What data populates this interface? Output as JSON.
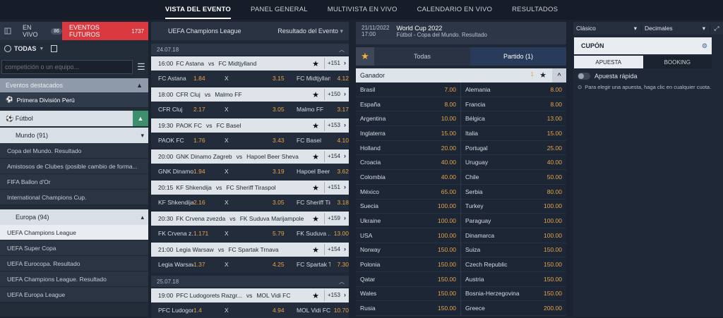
{
  "nav": {
    "tabs": [
      "VISTA DEL EVENTO",
      "PANEL GENERAL",
      "MULTIVISTA EN VIVO",
      "CALENDARIO EN VIVO",
      "RESULTADOS"
    ]
  },
  "left": {
    "live_label": "EN VIVO",
    "live_count": "86",
    "future_label": "EVENTOS FUTUROS",
    "future_count": "1737",
    "filter": "TODAS",
    "search_placeholder": "competición o un equipo...",
    "featured": "Eventos destacados",
    "featured_item": "Primera División Perú",
    "sport": "Fútbol",
    "group1": "Mundo (91)",
    "group1_items": [
      "Copa del Mundo. Resultado",
      "Amistosos de Clubes (posible cambio de forma...",
      "FIFA Ballon d'Or",
      "International Champions Cup."
    ],
    "group2": "Europa (94)",
    "group2_items": [
      "UEFA Champions League",
      "UEFA Super Copa",
      "UEFA Eurocopa. Resultado",
      "UEFA Champions League. Resultado",
      "UEFA Europa League"
    ]
  },
  "mid": {
    "league": "UEFA Champions League",
    "market": "Resultado del Evento",
    "date1": "24.07.18",
    "date2": "25.07.18",
    "matches": [
      {
        "time": "16:00",
        "home": "FC Astana",
        "away": "FC Midtjylland",
        "count": "+151",
        "h": "FC Astana",
        "o1": "1.84",
        "x": "X",
        "ox": "3.15",
        "a": "FC Midtjylland",
        "o2": "4.12"
      },
      {
        "time": "18:00",
        "home": "CFR Cluj",
        "away": "Malmo FF",
        "count": "+150",
        "h": "CFR Cluj",
        "o1": "2.17",
        "x": "X",
        "ox": "3.05",
        "a": "Malmo FF",
        "o2": "3.17"
      },
      {
        "time": "19:30",
        "home": "PAOK FC",
        "away": "FC Basel",
        "count": "+153",
        "h": "PAOK FC",
        "o1": "1.76",
        "x": "X",
        "ox": "3.43",
        "a": "FC Basel",
        "o2": "4.10"
      },
      {
        "time": "20:00",
        "home": "GNK Dinamo Zagreb",
        "away": "Hapoel Beer Sheva",
        "count": "+154",
        "h": "GNK Dinamo ...",
        "o1": "1.94",
        "x": "X",
        "ox": "3.19",
        "a": "Hapoel Beer ...",
        "o2": "3.62"
      },
      {
        "time": "20:15",
        "home": "KF Shkendija",
        "away": "FC Sheriff Tiraspol",
        "count": "+151",
        "h": "KF Shkendija",
        "o1": "2.16",
        "x": "X",
        "ox": "3.05",
        "a": "FC Sheriff Tir...",
        "o2": "3.18"
      },
      {
        "time": "20:30",
        "home": "FK Crvena zvezda",
        "away": "FK Suduva Marijampole",
        "count": "+159",
        "h": "FK Crvena z...",
        "o1": "1.171",
        "x": "X",
        "ox": "5.79",
        "a": "FK Suduva ...",
        "o2": "13.00"
      },
      {
        "time": "21:00",
        "home": "Legia Warsaw",
        "away": "FC Spartak Trnava",
        "count": "+154",
        "h": "Legia Warsaw",
        "o1": "1.37",
        "x": "X",
        "ox": "4.25",
        "a": "FC Spartak T...",
        "o2": "7.30"
      },
      {
        "time": "19:00",
        "home": "PFC Ludogorets Razgr...",
        "away": "MOL Vidi FC",
        "count": "+153",
        "h": "PFC Ludogor...",
        "o1": "1.4",
        "x": "X",
        "ox": "4.94",
        "a": "MOL Vidi FC",
        "o2": "10.70"
      }
    ]
  },
  "event": {
    "date": "21/11/2022",
    "time": "17:00",
    "title": "World Cup 2022",
    "subtitle": "Fútbol - Copa del Mundo. Resultado",
    "tab_all": "Todas",
    "tab_match": "Partido (1)",
    "market": "Ganador",
    "market_count": "1",
    "odds": [
      [
        "Brasil",
        "7.00"
      ],
      [
        "Alemania",
        "8.00"
      ],
      [
        "España",
        "8.00"
      ],
      [
        "Francia",
        "8.00"
      ],
      [
        "Argentina",
        "10.00"
      ],
      [
        "Bélgica",
        "13.00"
      ],
      [
        "Inglaterra",
        "15.00"
      ],
      [
        "Italia",
        "15.00"
      ],
      [
        "Holland",
        "20.00"
      ],
      [
        "Portugal",
        "25.00"
      ],
      [
        "Croacia",
        "40.00"
      ],
      [
        "Uruguay",
        "40.00"
      ],
      [
        "Colombia",
        "40.00"
      ],
      [
        "Chile",
        "50.00"
      ],
      [
        "México",
        "65.00"
      ],
      [
        "Serbia",
        "80.00"
      ],
      [
        "Suecia",
        "100.00"
      ],
      [
        "Turkey",
        "100.00"
      ],
      [
        "Ukraine",
        "100.00"
      ],
      [
        "Paraguay",
        "100.00"
      ],
      [
        "USA",
        "100.00"
      ],
      [
        "Dinamarca",
        "100.00"
      ],
      [
        "Norway",
        "150.00"
      ],
      [
        "Suiza",
        "150.00"
      ],
      [
        "Polonia",
        "150.00"
      ],
      [
        "Czech Republic",
        "150.00"
      ],
      [
        "Qatar",
        "150.00"
      ],
      [
        "Austria",
        "150.00"
      ],
      [
        "Wales",
        "150.00"
      ],
      [
        "Bosnia-Herzegovina",
        "150.00"
      ],
      [
        "Rusia",
        "150.00"
      ],
      [
        "Greece",
        "200.00"
      ]
    ]
  },
  "right": {
    "sel1": "Clásico",
    "sel2": "Decimales",
    "coupon": "CUPÓN",
    "tab1": "APUESTA",
    "tab2": "BOOKING",
    "rapid": "Apuesta rápida",
    "hint": "Para elegir una apuesta, haga clic en cualquier cuota."
  }
}
